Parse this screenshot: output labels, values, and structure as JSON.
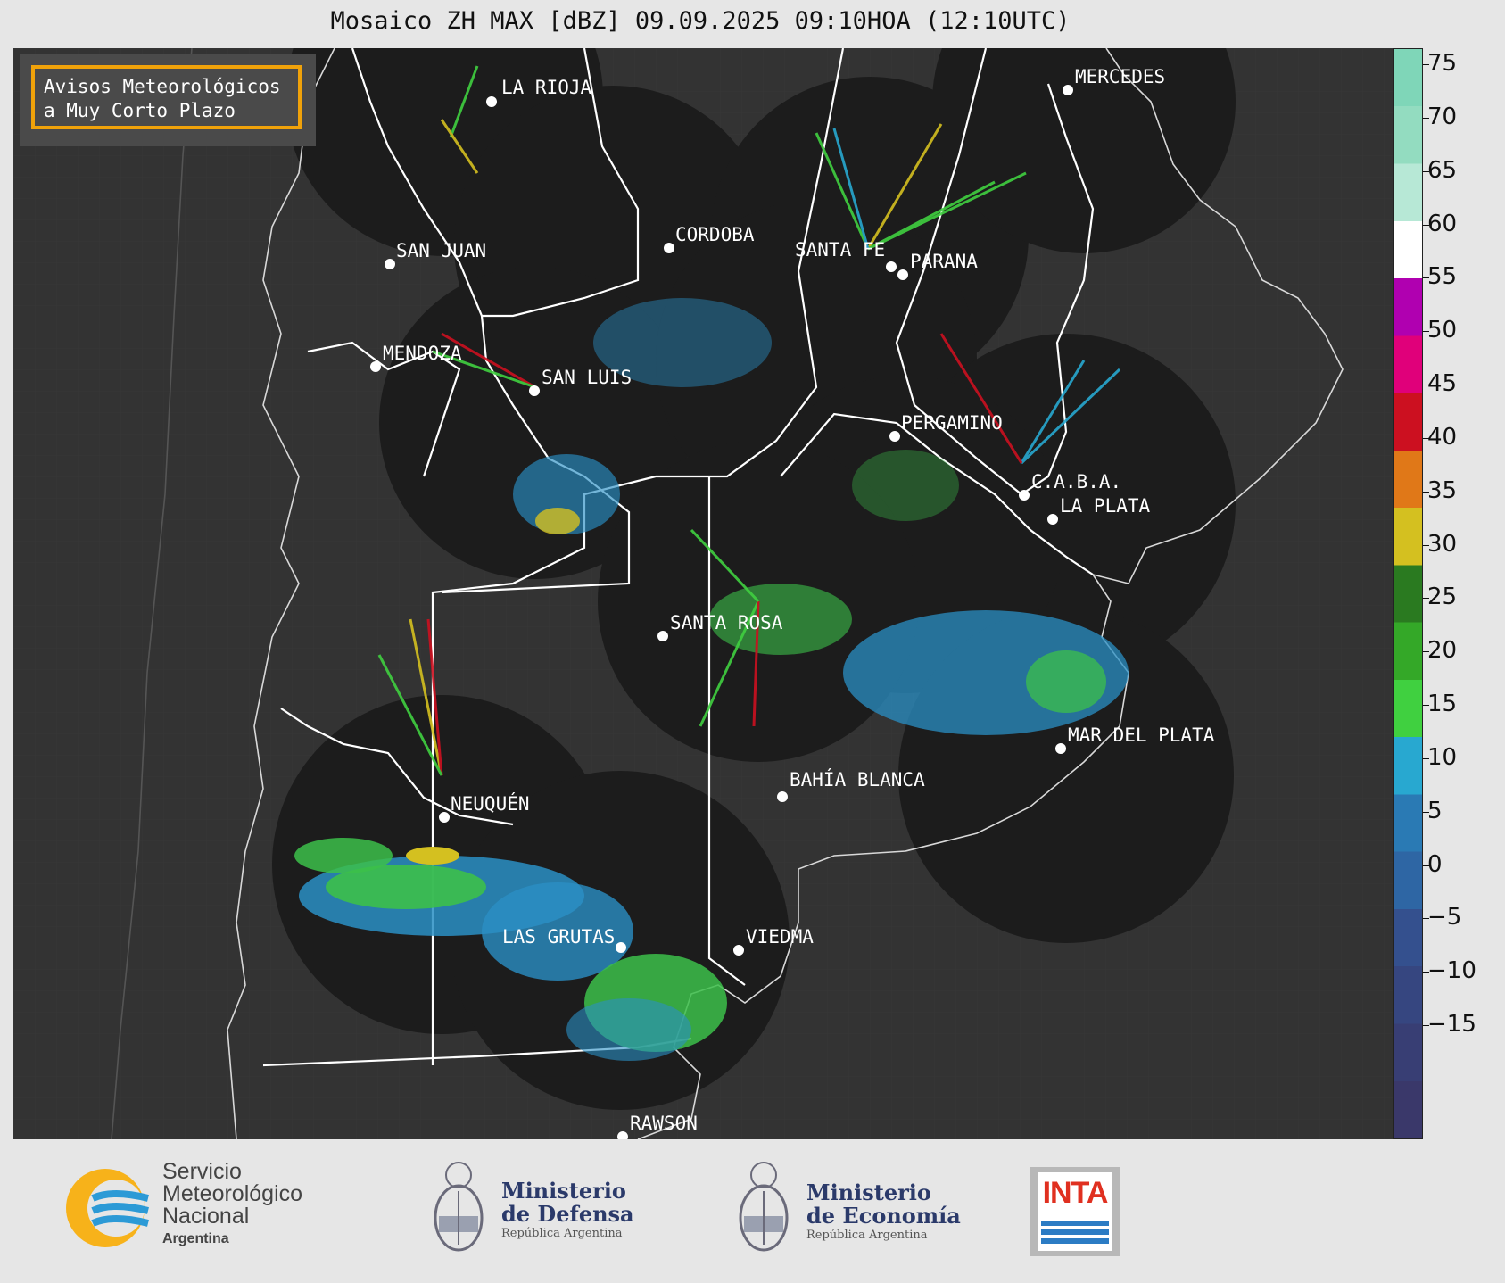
{
  "title": "Mosaico ZH MAX [dBZ] 09.09.2025 09:10HOA (12:10UTC)",
  "advisory": {
    "line1": "Avisos Meteorológicos",
    "line2": "a Muy Corto Plazo"
  },
  "colorbar": {
    "ticks": [
      "75",
      "70",
      "65",
      "60",
      "55",
      "50",
      "45",
      "40",
      "35",
      "30",
      "25",
      "20",
      "15",
      "10",
      "5",
      "0",
      "−5",
      "−10",
      "−15"
    ],
    "stops": [
      {
        "label": "75",
        "color": "#7fd6b8"
      },
      {
        "label": "70",
        "color": "#93dcc0"
      },
      {
        "label": "65",
        "color": "#b7e8d6"
      },
      {
        "label": "60",
        "color": "#ffffff"
      },
      {
        "label": "55",
        "color": "#b000b0"
      },
      {
        "label": "50",
        "color": "#e0007a"
      },
      {
        "label": "45",
        "color": "#cc1020"
      },
      {
        "label": "40",
        "color": "#e07818"
      },
      {
        "label": "35",
        "color": "#d4c020"
      },
      {
        "label": "30",
        "color": "#2a7a20"
      },
      {
        "label": "25",
        "color": "#34a828"
      },
      {
        "label": "20",
        "color": "#40d040"
      },
      {
        "label": "15",
        "color": "#28a8d0"
      },
      {
        "label": "10",
        "color": "#2a7ab4"
      },
      {
        "label": "5",
        "color": "#2e66a4"
      },
      {
        "label": "0",
        "color": "#34508e"
      },
      {
        "label": "−5",
        "color": "#364680"
      },
      {
        "label": "−10",
        "color": "#383e74"
      },
      {
        "label": "−15",
        "color": "#3a386a"
      }
    ]
  },
  "cities": [
    {
      "name": "LA RIOJA"
    },
    {
      "name": "CORDOBA"
    },
    {
      "name": "SANTA FE"
    },
    {
      "name": "PARANA"
    },
    {
      "name": "SAN JUAN"
    },
    {
      "name": "MENDOZA"
    },
    {
      "name": "SAN LUIS"
    },
    {
      "name": "MERCEDES"
    },
    {
      "name": "PERGAMINO"
    },
    {
      "name": "C.A.B.A."
    },
    {
      "name": "LA PLATA"
    },
    {
      "name": "SANTA ROSA"
    },
    {
      "name": "MAR DEL PLATA"
    },
    {
      "name": "BAHÍA BLANCA"
    },
    {
      "name": "NEUQUÉN"
    },
    {
      "name": "LAS GRUTAS"
    },
    {
      "name": "VIEDMA"
    },
    {
      "name": "RAWSON"
    }
  ],
  "footer": {
    "smn": {
      "line1": "Servicio",
      "line2": "Meteorológico",
      "line3": "Nacional",
      "line4": "Argentina"
    },
    "defensa": {
      "line1": "Ministerio",
      "line2": "de Defensa",
      "line3": "República Argentina"
    },
    "economia": {
      "line1": "Ministerio",
      "line2": "de Economía",
      "line3": "República Argentina"
    },
    "inta": {
      "label": "INTA"
    }
  }
}
